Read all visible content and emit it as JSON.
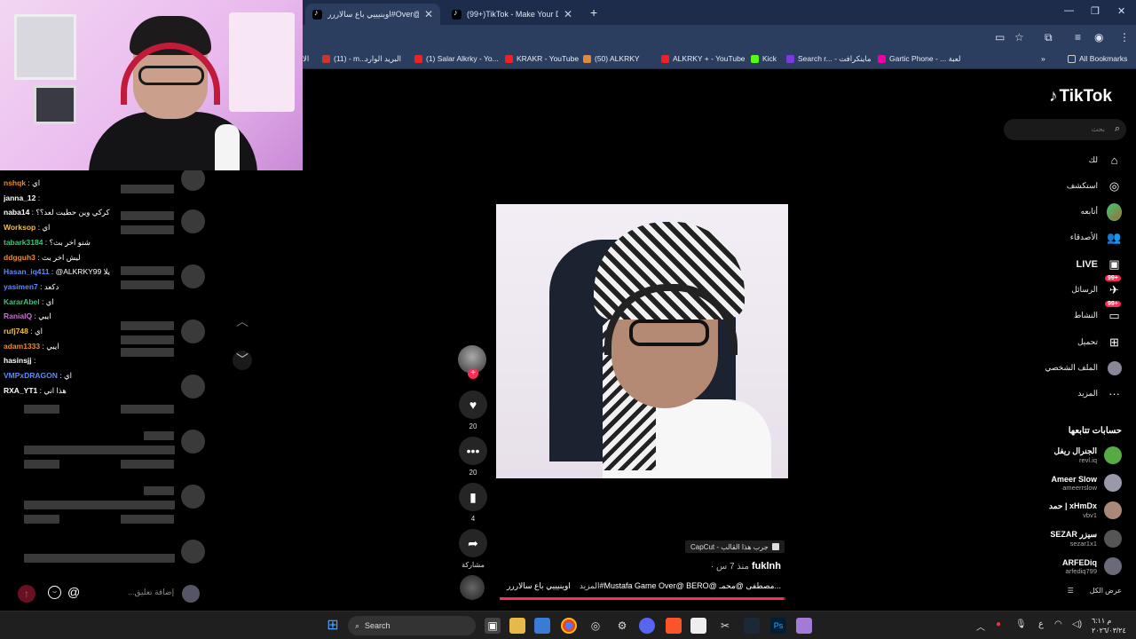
{
  "browser": {
    "tabs": [
      {
        "label": "اوينيييي باع سالاررر#Over@",
        "active": true
      },
      {
        "label": "(99+)TikTok - Make Your Day",
        "active": false
      }
    ],
    "bookmarks": [
      "الا",
      "(11) - m...",
      "البريد الوارد",
      "(1) Salar Alkrky - Yo...",
      "KRAKR - YouTube",
      "(50) ALKRKY",
      "ALKRKY + - YouTube",
      "Kick",
      "Search r... - ماينكرافت",
      "Gartic Phone - ... لعبة",
      "All Bookmarks"
    ]
  },
  "chat": {
    "messages": [
      {
        "user": "nshqk",
        "text": "اي",
        "color": "#f08a24"
      },
      {
        "user": "janna_12",
        "text": "",
        "color": "#ffffff"
      },
      {
        "user": "naba14",
        "text": "كركي وين حطيت لعد؟؟",
        "color": "#ffffff"
      },
      {
        "user": "Worksop",
        "text": "اي",
        "color": "#f0c040"
      },
      {
        "user": "tabark3184",
        "text": "شنو اخر بث؟",
        "color": "#3ac47a"
      },
      {
        "user": "ddgguh3",
        "text": "ليش اخر بث",
        "color": "#f08a24"
      },
      {
        "user": "Hasan_iq411",
        "text": "@ALKRKY99 يلا",
        "color": "#5a8cff"
      },
      {
        "user": "yasimen7",
        "text": "دكعد",
        "color": "#5a8cff"
      },
      {
        "user": "KararAbel",
        "text": "اي",
        "color": "#3ac47a"
      },
      {
        "user": "RaniaIQ",
        "text": "ايبي",
        "color": "#d06bd8"
      },
      {
        "user": "rufj748",
        "text": "اي",
        "color": "#f0c040"
      },
      {
        "user": "adam1333",
        "text": "ايبي",
        "color": "#f08a24"
      },
      {
        "user": "hasinsjj",
        "text": "",
        "color": "#ffffff"
      },
      {
        "user": "VMPxDRAGON",
        "text": "اي",
        "color": "#5a8cff"
      },
      {
        "user": "RXA_YT1",
        "text": "هذا اني",
        "color": "#ffffff"
      }
    ],
    "input_placeholder": "...إضافة تعليق",
    "at_symbol": "@"
  },
  "video": {
    "likes": "20",
    "comments": "20",
    "saves": "4",
    "share_label": "مشاركة",
    "capcut_label": "CapCut - جرب هذا القالب",
    "author": "fuklnh",
    "time_ago": "· منذ 7 س",
    "caption": "اوينيييي باع سالاررر#Mustafa Game Over@ BERO@ مصطفى @محمـ...",
    "more_label": "المزيد",
    "progress": 0.995
  },
  "sidebar": {
    "logo": "TikTok",
    "search_placeholder": "بحث",
    "nav": [
      {
        "label": "لك",
        "icon": "home-icon",
        "glyph": "⌂"
      },
      {
        "label": "استكشف",
        "icon": "compass-icon",
        "glyph": "◎"
      },
      {
        "label": "أتابعه",
        "icon": "following-avatar-icon",
        "glyph": ""
      },
      {
        "label": "الأصدقاء",
        "icon": "friends-icon",
        "glyph": "👥"
      },
      {
        "label": "LIVE",
        "icon": "live-icon",
        "glyph": "▣"
      },
      {
        "label": "الرسائل",
        "icon": "messages-icon",
        "glyph": "✈",
        "badge": "99+"
      },
      {
        "label": "النشاط",
        "icon": "activity-icon",
        "glyph": "▭",
        "badge": "99+"
      },
      {
        "label": "تحميل",
        "icon": "upload-icon",
        "glyph": "⊞"
      },
      {
        "label": "الملف الشخصي",
        "icon": "profile-icon",
        "glyph": ""
      },
      {
        "label": "المزيد",
        "icon": "more-icon",
        "glyph": "···"
      }
    ],
    "following_title": "حسابات تتابعها",
    "accounts": [
      {
        "name": "الجنرال ريفل",
        "handle": "revl.iq"
      },
      {
        "name": "Ameer Slow",
        "handle": "ameerrslow"
      },
      {
        "name": "حمد | xHmDx",
        "handle": "vbv1"
      },
      {
        "name": "SEZAR سيزر",
        "handle": "sezar1x1"
      },
      {
        "name": "ARFEDiq",
        "handle": "arfediq799"
      }
    ],
    "see_all": "عرض الكل"
  },
  "taskbar": {
    "search_label": "Search",
    "time": "م ٦:١١",
    "date": "٢٠٢٦/٠٣/٢٤",
    "lang": "ع"
  },
  "colors": {
    "tiktok_red": "#fe2c55",
    "chrome_dark": "#1c2c4a",
    "chrome_toolbar": "#2c3e5f"
  }
}
